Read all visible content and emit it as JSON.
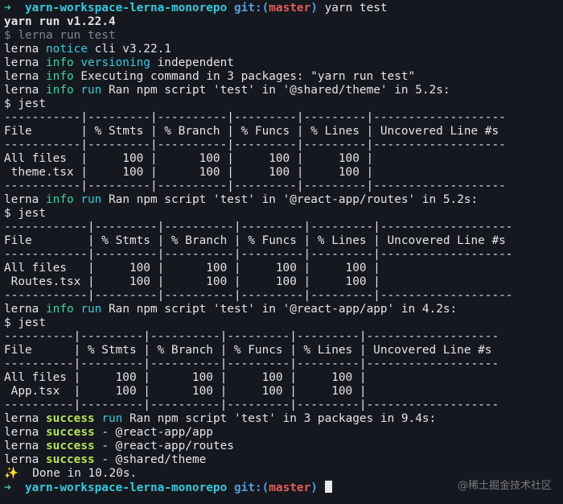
{
  "prompt": {
    "arrow": "➜",
    "dir": "yarn-workspace-lerna-monorepo",
    "git_label": "git:",
    "paren_open": "(",
    "branch": "master",
    "paren_close": ")"
  },
  "command": "yarn test",
  "yarn_version": "yarn run v1.22.4",
  "lerna_run": "$ lerna run test",
  "lerna_word": "lerna",
  "notice_word": "notice",
  "info_word": "info",
  "run_word": "run",
  "success_word": "success",
  "cli_line": "cli v3.22.1",
  "versioning_word": "versioning",
  "versioning_value": "independent",
  "exec_text": "Executing command in 3 packages: \"yarn run test\"",
  "jest_cmd": "$ jest",
  "runs": [
    {
      "ran": "Ran npm script 'test' in '@shared/theme' in 5.2s:",
      "table": [
        "-----------|---------|----------|---------|---------|-------------------",
        "File       | % Stmts | % Branch | % Funcs | % Lines | Uncovered Line #s ",
        "-----------|---------|----------|---------|---------|-------------------",
        "All files  |     100 |      100 |     100 |     100 |                   ",
        " theme.tsx |     100 |      100 |     100 |     100 |                   ",
        "-----------|---------|----------|---------|---------|-------------------"
      ]
    },
    {
      "ran": "Ran npm script 'test' in '@react-app/routes' in 5.2s:",
      "table": [
        "------------|---------|----------|---------|---------|-------------------",
        "File        | % Stmts | % Branch | % Funcs | % Lines | Uncovered Line #s ",
        "------------|---------|----------|---------|---------|-------------------",
        "All files   |     100 |      100 |     100 |     100 |                   ",
        " Routes.tsx |     100 |      100 |     100 |     100 |                   ",
        "------------|---------|----------|---------|---------|-------------------"
      ]
    },
    {
      "ran": "Ran npm script 'test' in '@react-app/app' in 4.2s:",
      "table": [
        "----------|---------|----------|---------|---------|-------------------",
        "File      | % Stmts | % Branch | % Funcs | % Lines | Uncovered Line #s ",
        "----------|---------|----------|---------|---------|-------------------",
        "All files |     100 |      100 |     100 |     100 |                   ",
        " App.tsx  |     100 |      100 |     100 |     100 |                   ",
        "----------|---------|----------|---------|---------|-------------------"
      ]
    }
  ],
  "success_summary": "Ran npm script 'test' in 3 packages in 9.4s:",
  "success_items": [
    "- @react-app/app",
    "- @react-app/routes",
    "- @shared/theme"
  ],
  "done_icon": "✨",
  "done_text": "Done in 10.20s.",
  "watermark": "@稀土掘金技术社区",
  "colors": {
    "background": "#15191f",
    "green": "#3dd39a",
    "cyan": "#38c9dc",
    "red": "#e05d5d",
    "yellow": "#f0c94a",
    "success": "#b7e35a"
  }
}
